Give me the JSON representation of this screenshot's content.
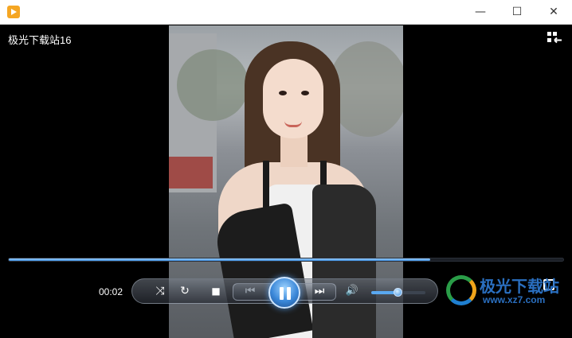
{
  "window": {
    "minimize_glyph": "—",
    "maximize_glyph": "☐",
    "close_glyph": "✕"
  },
  "video": {
    "title": "极光下载站16",
    "playlist_icon": "playlist-toggle-icon"
  },
  "playback": {
    "elapsed": "00:02",
    "progress_fraction": 0.76,
    "volume_fraction": 0.5,
    "state": "playing"
  },
  "controls": {
    "shuffle_glyph": "⤨",
    "repeat_glyph": "↻",
    "stop_glyph": "■",
    "prev_glyph": "⏮",
    "next_glyph": "⏭",
    "volume_glyph": "🔊"
  },
  "watermark": {
    "brand": "极光下载站",
    "url": "www.xz7.com"
  },
  "colors": {
    "accent": "#3d8ee0",
    "app_icon": "#f5a623"
  }
}
